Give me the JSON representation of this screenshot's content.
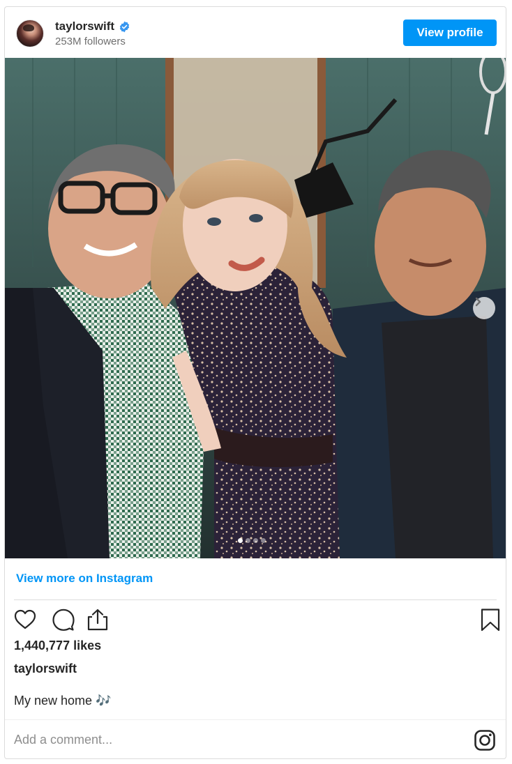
{
  "header": {
    "username": "taylorswift",
    "followers": "253M followers",
    "view_profile_label": "View profile",
    "verified_icon": "verified-badge-icon",
    "verified_color": "#3897f0"
  },
  "media": {
    "description_icon": "photo",
    "carousel_total": 4,
    "carousel_active": 1,
    "next_icon": "chevron-right-icon"
  },
  "footer": {
    "view_more_label": "View more on Instagram",
    "likes": "1,440,777 likes",
    "caption_username": "taylorswift",
    "caption_text": "My new home 🎶",
    "comment_placeholder": "Add a comment...",
    "icons": [
      "heart-icon",
      "comment-icon",
      "share-icon",
      "bookmark-icon",
      "instagram-logo-icon"
    ]
  },
  "colors": {
    "accent": "#0095f6",
    "border": "#dbdbdb",
    "text": "#262626",
    "muted": "#8e8e8e"
  }
}
